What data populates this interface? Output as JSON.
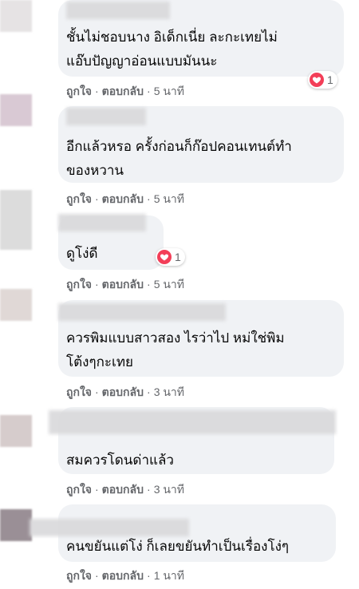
{
  "colors": {
    "bubble": "#f0f2f5",
    "meta": "#65676b",
    "heart": "#f33e58"
  },
  "comments": [
    {
      "text": "ชั้นไม่ชอบนาง อิเด็กเนี่ย ละกะเทยไม่\nแอ๊บปัญญาอ่อนแบบมันนะ",
      "like_label": "ถูกใจ",
      "reply_label": "ตอบกลับ",
      "time": "5 นาที",
      "reaction": {
        "icon": "heart-icon",
        "count": "1"
      }
    },
    {
      "text": "อีกแล้วหรอ ครั้งก่อนก็ก๊อปคอนเทนต์ทำ\nของหวาน",
      "like_label": "ถูกใจ",
      "reply_label": "ตอบกลับ",
      "time": "5 นาที"
    },
    {
      "text": "ดูโง่ดี",
      "like_label": "ถูกใจ",
      "reply_label": "ตอบกลับ",
      "time": "5 นาที",
      "reaction": {
        "icon": "heart-icon",
        "count": "1"
      }
    },
    {
      "text": "ควรพิมแบบสาวสอง ไรว่าไป หม่ใช่พิม\nโต้งๆกะเทย",
      "like_label": "ถูกใจ",
      "reply_label": "ตอบกลับ",
      "time": "3 นาที"
    },
    {
      "text": "สมควรโดนด่าแล้ว",
      "like_label": "ถูกใจ",
      "reply_label": "ตอบกลับ",
      "time": "3 นาที"
    },
    {
      "text": "คนขยันแต่โง่ ก็เลยขยันทำเป็นเรื่องโง่ๆ",
      "like_label": "ถูกใจ",
      "reply_label": "ตอบกลับ",
      "time": "1 นาที"
    }
  ]
}
